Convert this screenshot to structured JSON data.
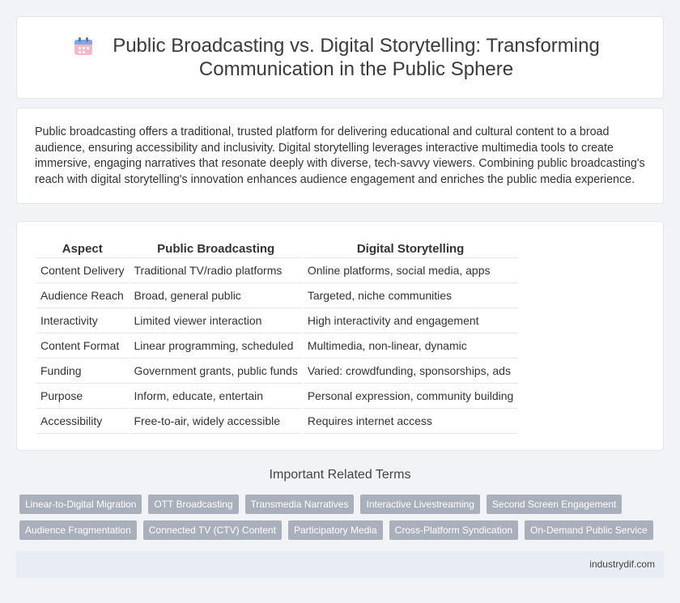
{
  "header": {
    "title": "Public Broadcasting vs. Digital Storytelling: Transforming Communication in the Public Sphere",
    "icon": "calendar-icon"
  },
  "intro": {
    "text": "Public broadcasting offers a traditional, trusted platform for delivering educational and cultural content to a broad audience, ensuring accessibility and inclusivity. Digital storytelling leverages interactive multimedia tools to create immersive, engaging narratives that resonate deeply with diverse, tech-savvy viewers. Combining public broadcasting's reach with digital storytelling's innovation enhances audience engagement and enriches the public media experience."
  },
  "table": {
    "headers": [
      "Aspect",
      "Public Broadcasting",
      "Digital Storytelling"
    ],
    "rows": [
      [
        "Content Delivery",
        "Traditional TV/radio platforms",
        "Online platforms, social media, apps"
      ],
      [
        "Audience Reach",
        "Broad, general public",
        "Targeted, niche communities"
      ],
      [
        "Interactivity",
        "Limited viewer interaction",
        "High interactivity and engagement"
      ],
      [
        "Content Format",
        "Linear programming, scheduled",
        "Multimedia, non-linear, dynamic"
      ],
      [
        "Funding",
        "Government grants, public funds",
        "Varied: crowdfunding, sponsorships, ads"
      ],
      [
        "Purpose",
        "Inform, educate, entertain",
        "Personal expression, community building"
      ],
      [
        "Accessibility",
        "Free-to-air, widely accessible",
        "Requires internet access"
      ]
    ]
  },
  "related": {
    "title": "Important Related Terms",
    "row1": [
      "Linear-to-Digital Migration",
      "OTT Broadcasting",
      "Transmedia Narratives",
      "Interactive Livestreaming",
      "Second Screen Engagement"
    ],
    "row2": [
      "Audience Fragmentation",
      "Connected TV (CTV) Content",
      "Participatory Media",
      "Cross-Platform Syndication",
      "On-Demand Public Service"
    ]
  },
  "footer": {
    "site": "industrydif.com"
  }
}
